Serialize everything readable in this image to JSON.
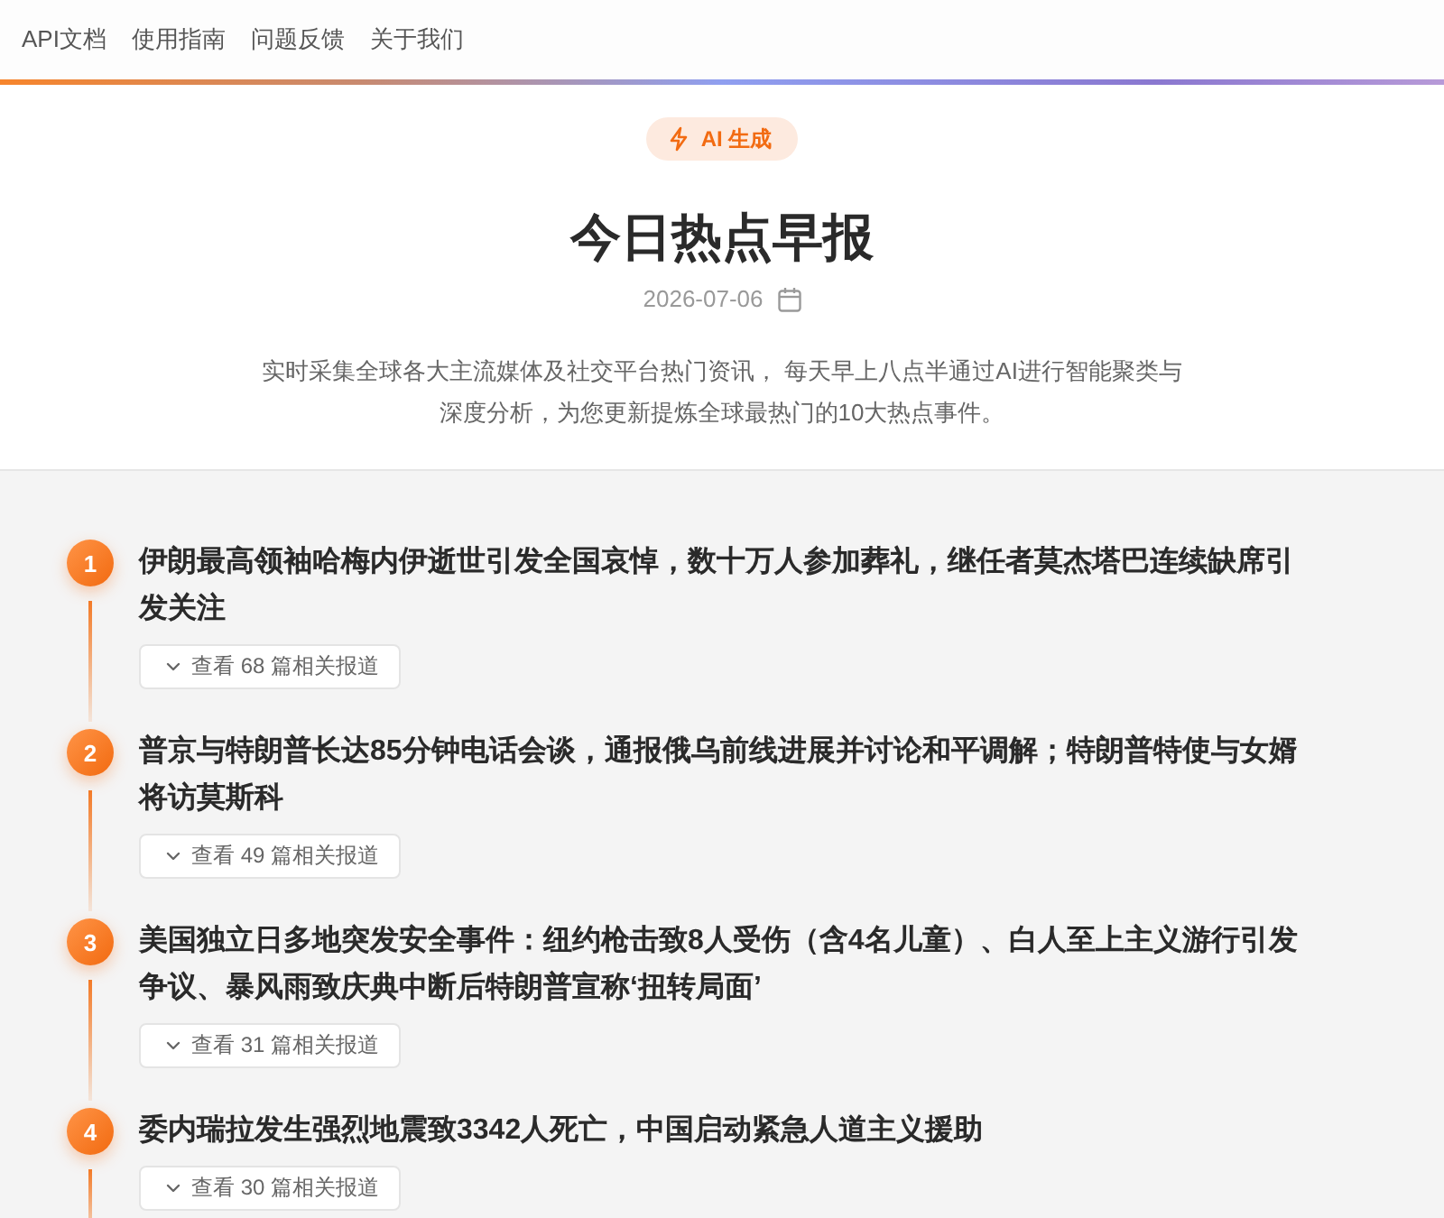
{
  "nav": {
    "links": [
      "API文档",
      "使用指南",
      "问题反馈",
      "关于我们"
    ]
  },
  "header": {
    "badge": "AI 生成",
    "title": "今日热点早报",
    "date": "2026-07-06",
    "description": "实时采集全球各大主流媒体及社交平台热门资讯， 每天早上八点半通过AI进行智能聚类与深度分析，为您更新提炼全球最热门的10大热点事件。"
  },
  "events": [
    {
      "rank": "1",
      "title": "伊朗最高领袖哈梅内伊逝世引发全国哀悼，数十万人参加葬礼，继任者莫杰塔巴连续缺席引发关注",
      "related": "查看 68 篇相关报道",
      "expanded": false
    },
    {
      "rank": "2",
      "title": "普京与特朗普长达85分钟电话会谈，通报俄乌前线进展并讨论和平调解；特朗普特使与女婿将访莫斯科",
      "related": "查看 49 篇相关报道",
      "expanded": false
    },
    {
      "rank": "3",
      "title": "美国独立日多地突发安全事件：纽约枪击致8人受伤（含4名儿童）、白人至上主义游行引发争议、暴风雨致庆典中断后特朗普宣称‘扭转局面’",
      "related": "查看 31 篇相关报道",
      "expanded": false
    },
    {
      "rank": "4",
      "title": "委内瑞拉发生强烈地震致3342人死亡，中国启动紧急人道主义援助",
      "related": "查看 30 篇相关报道",
      "expanded": false
    }
  ]
}
